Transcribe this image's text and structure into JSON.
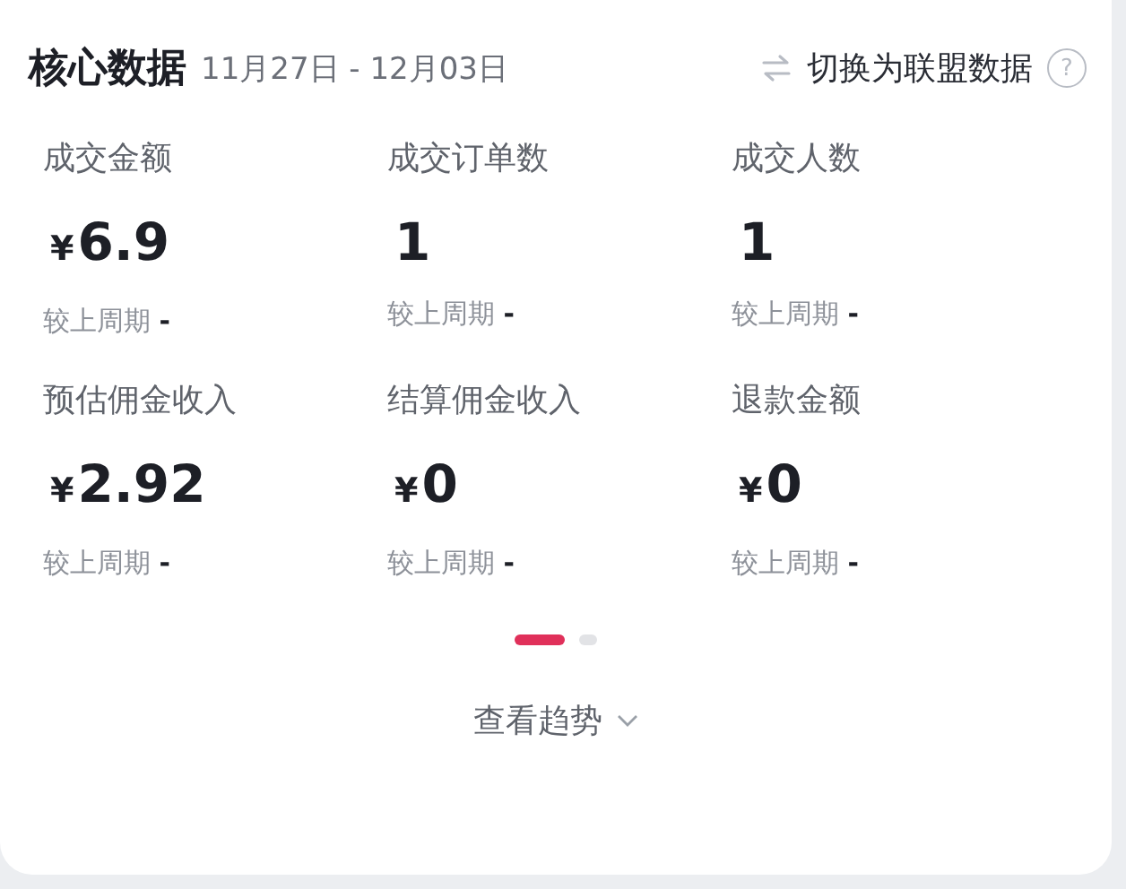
{
  "header": {
    "title": "核心数据",
    "date_range": "11月27日 - 12月03日",
    "switch_label": "切换为联盟数据",
    "help": "?"
  },
  "metrics": [
    {
      "label": "成交金额",
      "currency": "¥",
      "value": "6.9",
      "compare_label": "较上周期",
      "compare_value": "-"
    },
    {
      "label": "成交订单数",
      "value": "1",
      "compare_label": "较上周期",
      "compare_value": "-"
    },
    {
      "label": "成交人数",
      "value": "1",
      "compare_label": "较上周期",
      "compare_value": "-"
    },
    {
      "label": "预估佣金收入",
      "currency": "¥",
      "value": "2.92",
      "compare_label": "较上周期",
      "compare_value": "-"
    },
    {
      "label": "结算佣金收入",
      "currency": "¥",
      "value": "0",
      "compare_label": "较上周期",
      "compare_value": "-"
    },
    {
      "label": "退款金额",
      "currency": "¥",
      "value": "0",
      "compare_label": "较上周期",
      "compare_value": "-"
    }
  ],
  "pages": [
    {
      "selected": true
    },
    {
      "selected": false
    }
  ],
  "trend_link": "查看趋势"
}
